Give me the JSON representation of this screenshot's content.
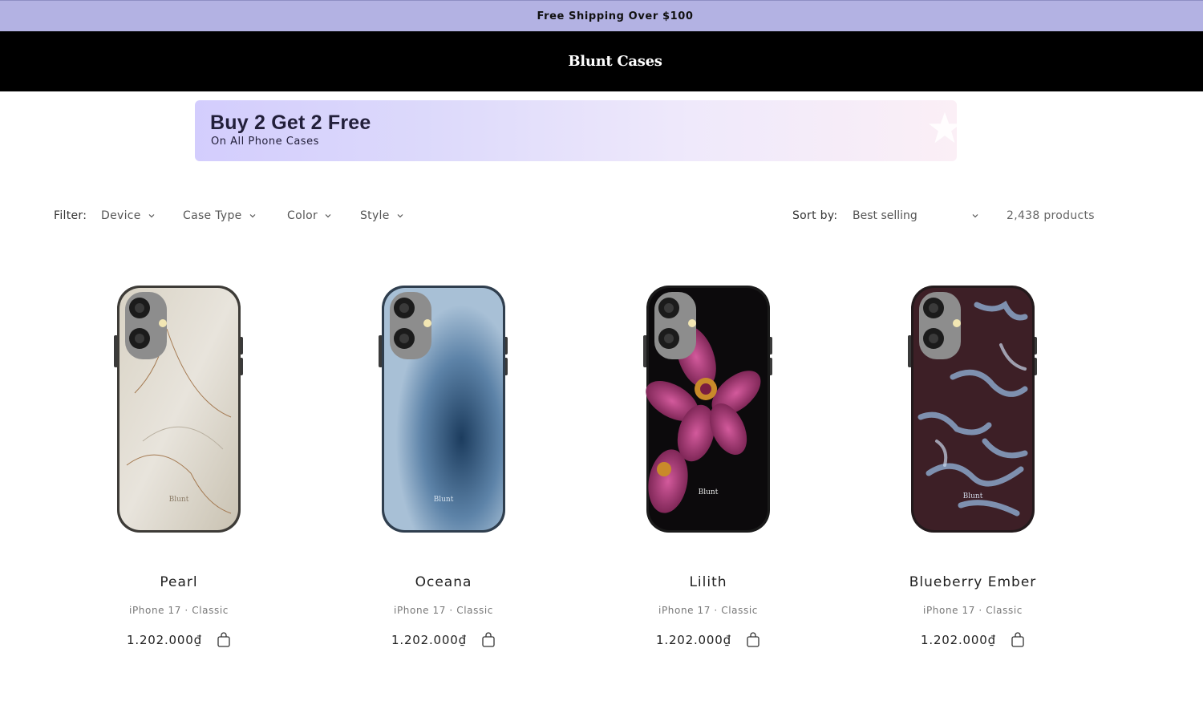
{
  "announcement": {
    "text": "Free Shipping Over $100"
  },
  "header": {
    "logo": "Blunt Cases"
  },
  "promo": {
    "title": "Buy 2 Get 2 Free",
    "subtitle": "On All Phone Cases"
  },
  "facets": {
    "filter_label": "Filter:",
    "filters": [
      {
        "label": "Device"
      },
      {
        "label": "Case Type"
      },
      {
        "label": "Color"
      },
      {
        "label": "Style"
      }
    ],
    "sort_label": "Sort by:",
    "sort_value": "Best selling",
    "product_count": "2,438 products"
  },
  "products": [
    {
      "title": "Pearl",
      "variant": "iPhone 17 · Classic",
      "price": "1.202.000₫",
      "brand_mark": "Blunt"
    },
    {
      "title": "Oceana",
      "variant": "iPhone 17 · Classic",
      "price": "1.202.000₫",
      "brand_mark": "Blunt"
    },
    {
      "title": "Lilith",
      "variant": "iPhone 17 · Classic",
      "price": "1.202.000₫",
      "brand_mark": "Blunt"
    },
    {
      "title": "Blueberry Ember",
      "variant": "iPhone 17 · Classic",
      "price": "1.202.000₫",
      "brand_mark": "Blunt"
    }
  ],
  "colors": {
    "announcement_bg": "#b3b2e3",
    "header_bg": "#000000",
    "promo_start": "#d3cdfd",
    "promo_end": "#fbeff6"
  }
}
